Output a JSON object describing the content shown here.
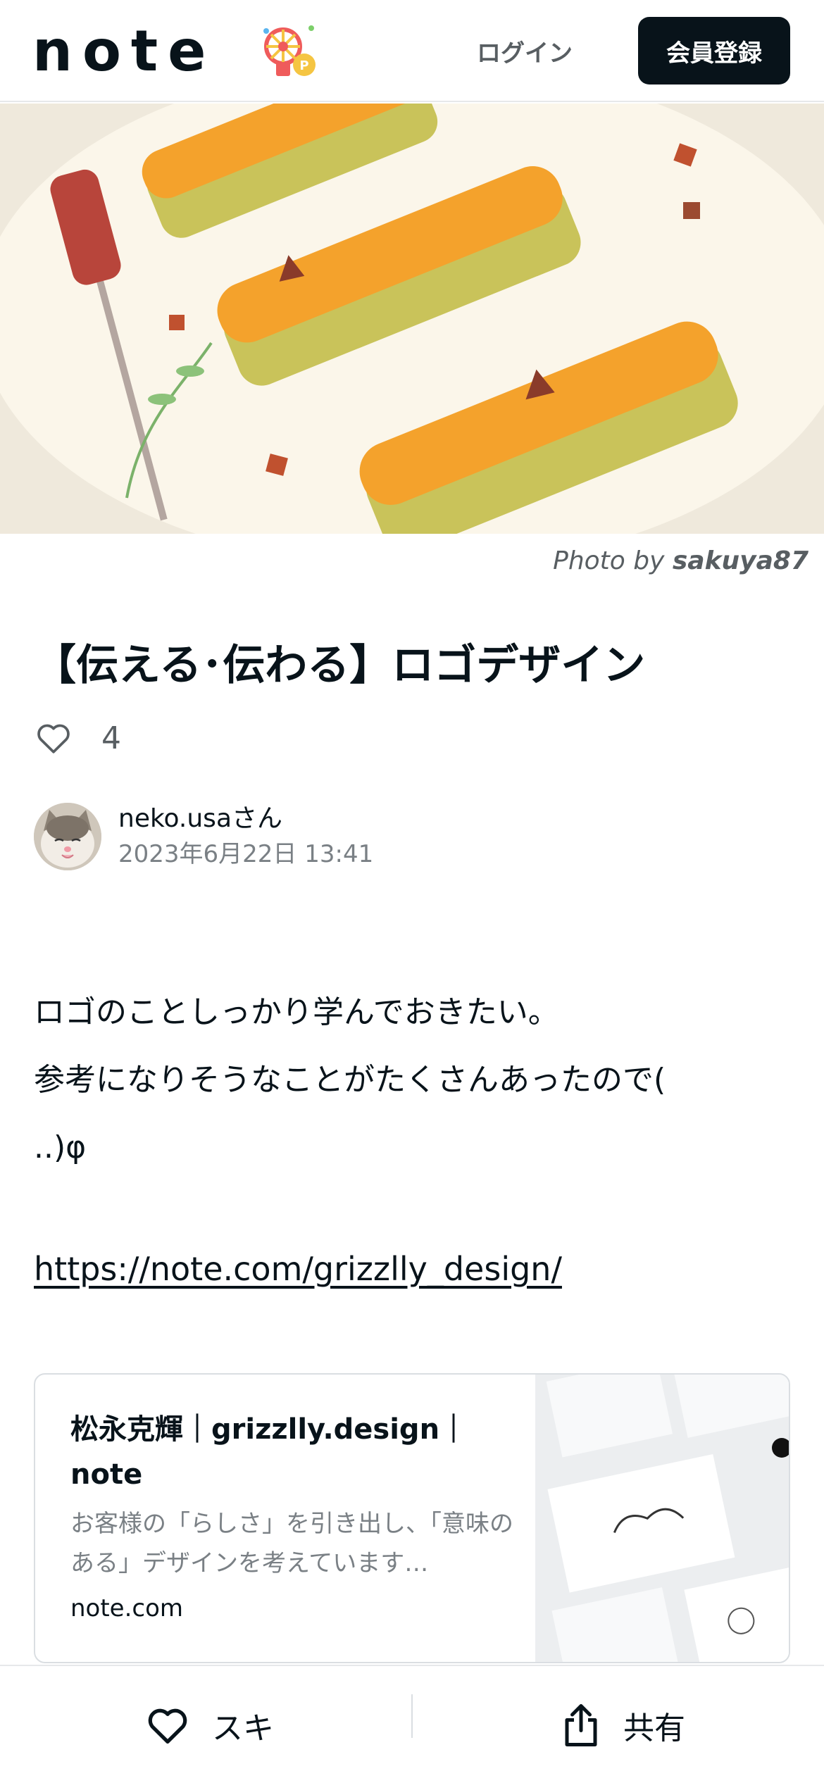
{
  "header": {
    "logo_text": "note",
    "login_label": "ログイン",
    "signup_label": "会員登録"
  },
  "hero": {
    "credit_prefix": "Photo by ",
    "credit_author": "sakuya87"
  },
  "article": {
    "title": "【伝える･伝わる】ロゴデザイン",
    "like_count": "4",
    "author_name": "neko.usaさん",
    "date": "2023年6月22日 13:41",
    "body_lines": [
      "ロゴのことしっかり学んでおきたい。",
      "参考になりそうなことがたくさんあったので(",
      "..)φ"
    ],
    "link_text": "https://note.com/grizzlly_design/"
  },
  "embed": {
    "title": "松永克輝｜grizzlly.design｜note",
    "description": "お客様の「らしさ」を引き出し、「意味のある」デザインを考えています…",
    "domain": "note.com"
  },
  "bottom_bar": {
    "like_label": "スキ",
    "share_label": "共有"
  },
  "icons": {
    "like": "heart-icon",
    "share": "share-icon",
    "badge": "event-badge-icon"
  }
}
